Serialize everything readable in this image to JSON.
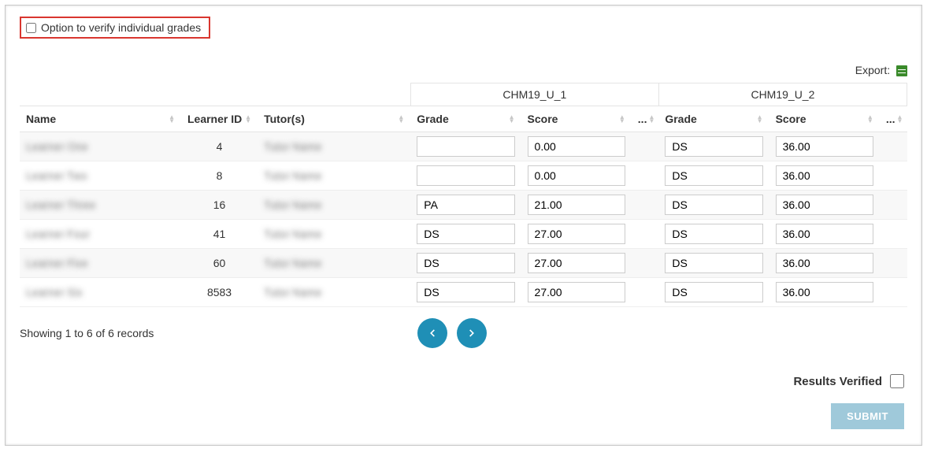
{
  "verify_option_label": "Option to verify individual grades",
  "export_label": "Export:",
  "groups": [
    "CHM19_U_1",
    "CHM19_U_2"
  ],
  "columns": {
    "name": "Name",
    "learner_id": "Learner ID",
    "tutors": "Tutor(s)",
    "grade": "Grade",
    "score": "Score",
    "ellipsis": "..."
  },
  "rows": [
    {
      "name": "Learner One",
      "learner_id": "4",
      "tutor": "Tutor Name",
      "u1_grade": "",
      "u1_score": "0.00",
      "u2_grade": "DS",
      "u2_score": "36.00"
    },
    {
      "name": "Learner Two",
      "learner_id": "8",
      "tutor": "Tutor Name",
      "u1_grade": "",
      "u1_score": "0.00",
      "u2_grade": "DS",
      "u2_score": "36.00"
    },
    {
      "name": "Learner Three",
      "learner_id": "16",
      "tutor": "Tutor Name",
      "u1_grade": "PA",
      "u1_score": "21.00",
      "u2_grade": "DS",
      "u2_score": "36.00"
    },
    {
      "name": "Learner Four",
      "learner_id": "41",
      "tutor": "Tutor Name",
      "u1_grade": "DS",
      "u1_score": "27.00",
      "u2_grade": "DS",
      "u2_score": "36.00"
    },
    {
      "name": "Learner Five",
      "learner_id": "60",
      "tutor": "Tutor Name",
      "u1_grade": "DS",
      "u1_score": "27.00",
      "u2_grade": "DS",
      "u2_score": "36.00"
    },
    {
      "name": "Learner Six",
      "learner_id": "8583",
      "tutor": "Tutor Name",
      "u1_grade": "DS",
      "u1_score": "27.00",
      "u2_grade": "DS",
      "u2_score": "36.00"
    }
  ],
  "records_info": "Showing 1 to 6 of 6 records",
  "results_verified_label": "Results Verified",
  "submit_label": "SUBMIT"
}
